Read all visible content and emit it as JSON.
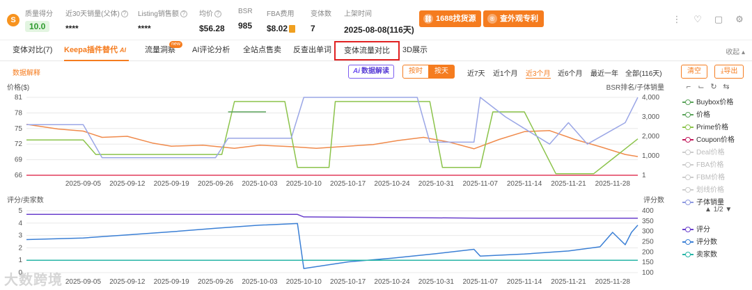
{
  "stats": {
    "quality_label": "质量得分",
    "quality_value": "10.0",
    "sales30_label": "近30天销量(父体)",
    "sales30_value": "****",
    "listing_label": "Listing销售额",
    "listing_value": "****",
    "price_label": "均价",
    "price_value": "$56.28",
    "bsr_label": "BSR",
    "bsr_value": "985",
    "fba_label": "FBA费用",
    "fba_value": "$8.02",
    "variants_label": "变体数",
    "variants_value": "7",
    "listed_label": "上架时间",
    "listed_value": "2025-08-08(116天)"
  },
  "buttons": {
    "source_1688": "1688找货源",
    "patent": "查外观专利"
  },
  "tabs": [
    {
      "label": "变体对比(7)"
    },
    {
      "label": "Keepa插件替代",
      "tag": "AI"
    },
    {
      "label": "流量洞察",
      "tag": "new"
    },
    {
      "label": "AI评论分析"
    },
    {
      "label": "全站点售卖"
    },
    {
      "label": "反查出单词"
    },
    {
      "label": "变体流量对比"
    },
    {
      "label": "3D展示"
    }
  ],
  "collapse_label": "收起",
  "controls": {
    "data_explain": "数据解释",
    "ai_read": "数据解读",
    "ai_prefix": "Ai",
    "by_hour": "按时",
    "by_day": "按天",
    "ranges": [
      "近7天",
      "近1个月",
      "近3个月",
      "近6个月",
      "最近一年",
      "全部(116天)"
    ],
    "active_range": "近3个月",
    "clear": "清空",
    "export": "导出"
  },
  "chart_data": [
    {
      "type": "line",
      "ylabel": "价格($)",
      "y2label": "BSR排名/子体销量",
      "ylim": [
        66,
        81
      ],
      "yticks": [
        66,
        69,
        72,
        75,
        78,
        81
      ],
      "y2lim": [
        0,
        4000
      ],
      "y2ticks": [
        "1",
        "1,000",
        "2,000",
        "3,000",
        "4,000"
      ],
      "x_ticks": [
        "2025-09-05",
        "2025-09-12",
        "2025-09-19",
        "2025-09-26",
        "2025-10-03",
        "2025-10-10",
        "2025-10-17",
        "2025-10-24",
        "2025-10-31",
        "2025-11-07",
        "2025-11-14",
        "2025-11-21",
        "2025-11-28"
      ],
      "series": [
        {
          "name": "价格",
          "color": "#f08a4b",
          "axis": "left",
          "x": [
            "2025-08-27",
            "2025-09-01",
            "2025-09-05",
            "2025-09-08",
            "2025-09-12",
            "2025-09-16",
            "2025-09-19",
            "2025-09-24",
            "2025-09-29",
            "2025-10-03",
            "2025-10-08",
            "2025-10-12",
            "2025-10-17",
            "2025-10-21",
            "2025-10-25",
            "2025-10-29",
            "2025-11-02",
            "2025-11-06",
            "2025-11-10",
            "2025-11-14",
            "2025-11-18",
            "2025-11-22",
            "2025-11-26",
            "2025-11-30",
            "2025-12-02"
          ],
          "values": [
            75.8,
            74.9,
            74.5,
            73.3,
            73.5,
            72.2,
            71.6,
            71.8,
            71.2,
            71.8,
            71.5,
            71.2,
            71.6,
            71.9,
            72.7,
            73.3,
            72.4,
            71.1,
            72.9,
            74.4,
            74.6,
            72.9,
            71.5,
            70.0,
            69.6
          ]
        },
        {
          "name": "Prime价格",
          "color": "#8bc34a",
          "axis": "left",
          "x": [
            "2025-08-27",
            "2025-09-05",
            "2025-09-07",
            "2025-09-27",
            "2025-09-29",
            "2025-10-07",
            "2025-10-09",
            "2025-10-14",
            "2025-10-15",
            "2025-10-30",
            "2025-11-01",
            "2025-11-07",
            "2025-11-09",
            "2025-11-14",
            "2025-11-19",
            "2025-11-25",
            "2025-12-02"
          ],
          "values": [
            72.8,
            72.8,
            70.0,
            70.0,
            80.2,
            80.2,
            67.5,
            67.5,
            80.2,
            80.2,
            67.5,
            67.5,
            78.2,
            78.2,
            66.3,
            66.3,
            73.0
          ]
        },
        {
          "name": "子体销量",
          "color": "#9aa6e6",
          "axis": "right",
          "x": [
            "2025-08-27",
            "2025-09-05",
            "2025-09-08",
            "2025-09-26",
            "2025-09-28",
            "2025-10-08",
            "2025-10-10",
            "2025-10-28",
            "2025-10-30",
            "2025-11-06",
            "2025-11-07",
            "2025-11-11",
            "2025-11-18",
            "2025-11-21",
            "2025-11-24",
            "2025-11-30",
            "2025-12-02"
          ],
          "values": [
            2600,
            2600,
            900,
            900,
            1900,
            1900,
            4000,
            4000,
            1700,
            1700,
            4000,
            3000,
            1600,
            2700,
            1600,
            2700,
            4000
          ]
        },
        {
          "name": "Coupon价格",
          "color": "#e03a5a",
          "axis": "left",
          "x": [
            "2025-08-27",
            "2025-12-02"
          ],
          "values": [
            66.0,
            66.0
          ]
        },
        {
          "name": "Buybox价格",
          "color": "#5aa35a",
          "axis": "left",
          "x": [
            "2025-09-28",
            "2025-10-04"
          ],
          "values": [
            78.2,
            78.2
          ]
        }
      ]
    },
    {
      "type": "line",
      "ylabel": "评分/卖家数",
      "y2label": "评分数",
      "ylim": [
        0,
        5
      ],
      "yticks": [
        0,
        1,
        2,
        3,
        4,
        5
      ],
      "y2lim": [
        100,
        400
      ],
      "y2ticks": [
        100,
        150,
        200,
        250,
        300,
        350,
        400
      ],
      "x_ticks": [
        "2025-09-05",
        "2025-09-12",
        "2025-09-19",
        "2025-09-26",
        "2025-10-03",
        "2025-10-10",
        "2025-10-17",
        "2025-10-24",
        "2025-10-31",
        "2025-11-07",
        "2025-11-14",
        "2025-11-21",
        "2025-11-28"
      ],
      "series": [
        {
          "name": "评分",
          "color": "#6a3fcc",
          "axis": "left",
          "x": [
            "2025-08-27",
            "2025-10-09",
            "2025-10-10",
            "2025-11-07",
            "2025-11-30",
            "2025-12-02"
          ],
          "values": [
            4.7,
            4.7,
            4.5,
            4.4,
            4.4,
            4.4
          ]
        },
        {
          "name": "评分数",
          "color": "#3a7fd5",
          "axis": "right",
          "x": [
            "2025-08-27",
            "2025-09-05",
            "2025-09-12",
            "2025-09-19",
            "2025-09-26",
            "2025-10-03",
            "2025-10-09",
            "2025-10-10",
            "2025-10-17",
            "2025-10-24",
            "2025-10-31",
            "2025-11-06",
            "2025-11-07",
            "2025-11-14",
            "2025-11-21",
            "2025-11-26",
            "2025-11-28",
            "2025-11-30",
            "2025-12-01",
            "2025-12-02"
          ],
          "values": [
            260,
            268,
            283,
            298,
            315,
            330,
            338,
            120,
            152,
            170,
            192,
            213,
            180,
            190,
            205,
            225,
            295,
            235,
            295,
            330
          ]
        },
        {
          "name": "卖家数",
          "color": "#26b5a6",
          "axis": "left",
          "x": [
            "2025-08-27",
            "2025-12-02"
          ],
          "values": [
            1.0,
            1.0
          ]
        }
      ]
    }
  ],
  "legend_top": [
    {
      "name": "Buybox价格",
      "color": "#5aa35a",
      "dim": false
    },
    {
      "name": "价格",
      "color": "#5aa35a",
      "dim": false
    },
    {
      "name": "Prime价格",
      "color": "#8bc34a",
      "dim": false
    },
    {
      "name": "Coupon价格",
      "color": "#c2185b",
      "dim": false
    },
    {
      "name": "Deal价格",
      "color": "#cccccc",
      "dim": true
    },
    {
      "name": "FBA价格",
      "color": "#cccccc",
      "dim": true
    },
    {
      "name": "FBM价格",
      "color": "#cccccc",
      "dim": true
    },
    {
      "name": "划线价格",
      "color": "#cccccc",
      "dim": true
    },
    {
      "name": "子体销量",
      "color": "#8e99e0",
      "dim": false
    }
  ],
  "legend_pager": "1/2",
  "legend_bottom": [
    {
      "name": "评分",
      "color": "#6a3fcc"
    },
    {
      "name": "评分数",
      "color": "#3a7fd5"
    },
    {
      "name": "卖家数",
      "color": "#26b5a6"
    }
  ],
  "watermark": "大数跨境"
}
